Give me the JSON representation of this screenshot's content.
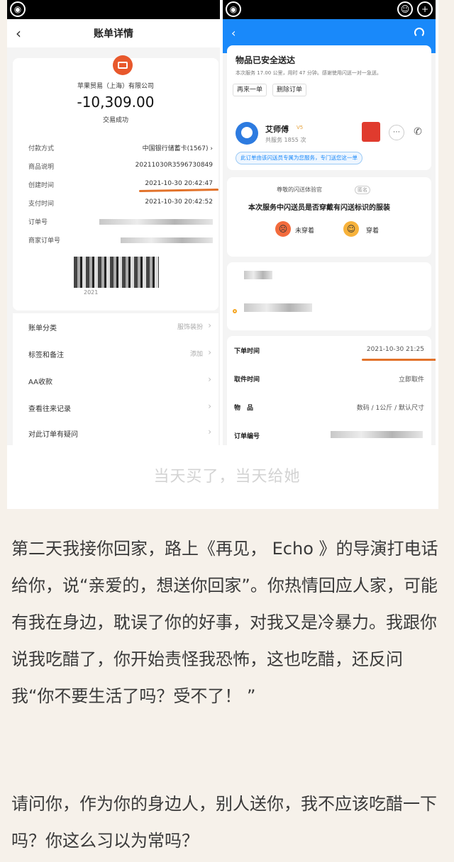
{
  "left_screen": {
    "title": "账单详情",
    "merchant": "苹果贸易（上海）有限公司",
    "amount": "-10,309.00",
    "status": "交易成功",
    "rows": [
      {
        "label": "付款方式",
        "value": "中国银行储蓄卡(1567)"
      },
      {
        "label": "商品说明",
        "value": "20211030R3596730849"
      },
      {
        "label": "创建时间",
        "value": "2021-10-30 20:42:47"
      },
      {
        "label": "支付时间",
        "value": "2021-10-30 20:42:52"
      },
      {
        "label": "订单号",
        "value": ""
      },
      {
        "label": "商家订单号",
        "value": ""
      }
    ],
    "qr_caption": "2021",
    "menu": [
      {
        "label": "账单分类",
        "value": "服饰装扮"
      },
      {
        "label": "标签和备注",
        "value": "添加"
      },
      {
        "label": "AA收款",
        "value": ""
      },
      {
        "label": "查看往来记录",
        "value": ""
      },
      {
        "label": "对此订单有疑问",
        "value": ""
      }
    ]
  },
  "right_screen": {
    "delivered_title": "物品已安全送达",
    "delivered_sub": "本次服务 17.00 公里，用时 47 分钟。感谢使用闪送一对一急送。",
    "reorder_button": "再来一单",
    "delete_button": "删除订单",
    "courier_name": "艾师傅",
    "courier_level": "V5",
    "courier_count": "共服务 1855 次",
    "courier_tag": "此订单由该闪送员专属为您服务，专门送您这一单",
    "survey_header": "尊敬的闪送体验官",
    "survey_badge": "匿名",
    "survey_question": "本次服务中闪送员是否穿戴有闪送标识的服装",
    "option_no": "未穿着",
    "option_yes": "穿着",
    "info_rows": [
      {
        "label": "下单时间",
        "value": "2021-10-30 21:25"
      },
      {
        "label": "取件时间",
        "value": "立即取件"
      },
      {
        "label": "物　品",
        "value": "数码 / 1公斤 / 默认尺寸"
      },
      {
        "label": "订单编号",
        "value": ""
      }
    ]
  },
  "caption": "当天买了，当天给她",
  "paragraphs": [
    "第二天我接你回家，路上《再见， Echo 》的导演打电话给你，说“亲爱的，想送你回家”。你热情回应人家，可能有我在身边，耽误了你的好事，对我又是冷暴力。我跟你说我吃醋了，你开始责怪我恐怖，这也吃醋，还反问我“你不要生活了吗？受不了！ ”",
    "请问你，作为你的身边人，别人送你，我不应该吃醋一下吗？你这么习以为常吗？"
  ],
  "colors": {
    "brand_blue": "#1989fa",
    "accent_orange": "#e8582c",
    "underline": "#e2722a",
    "background": "#f6f1ea"
  }
}
